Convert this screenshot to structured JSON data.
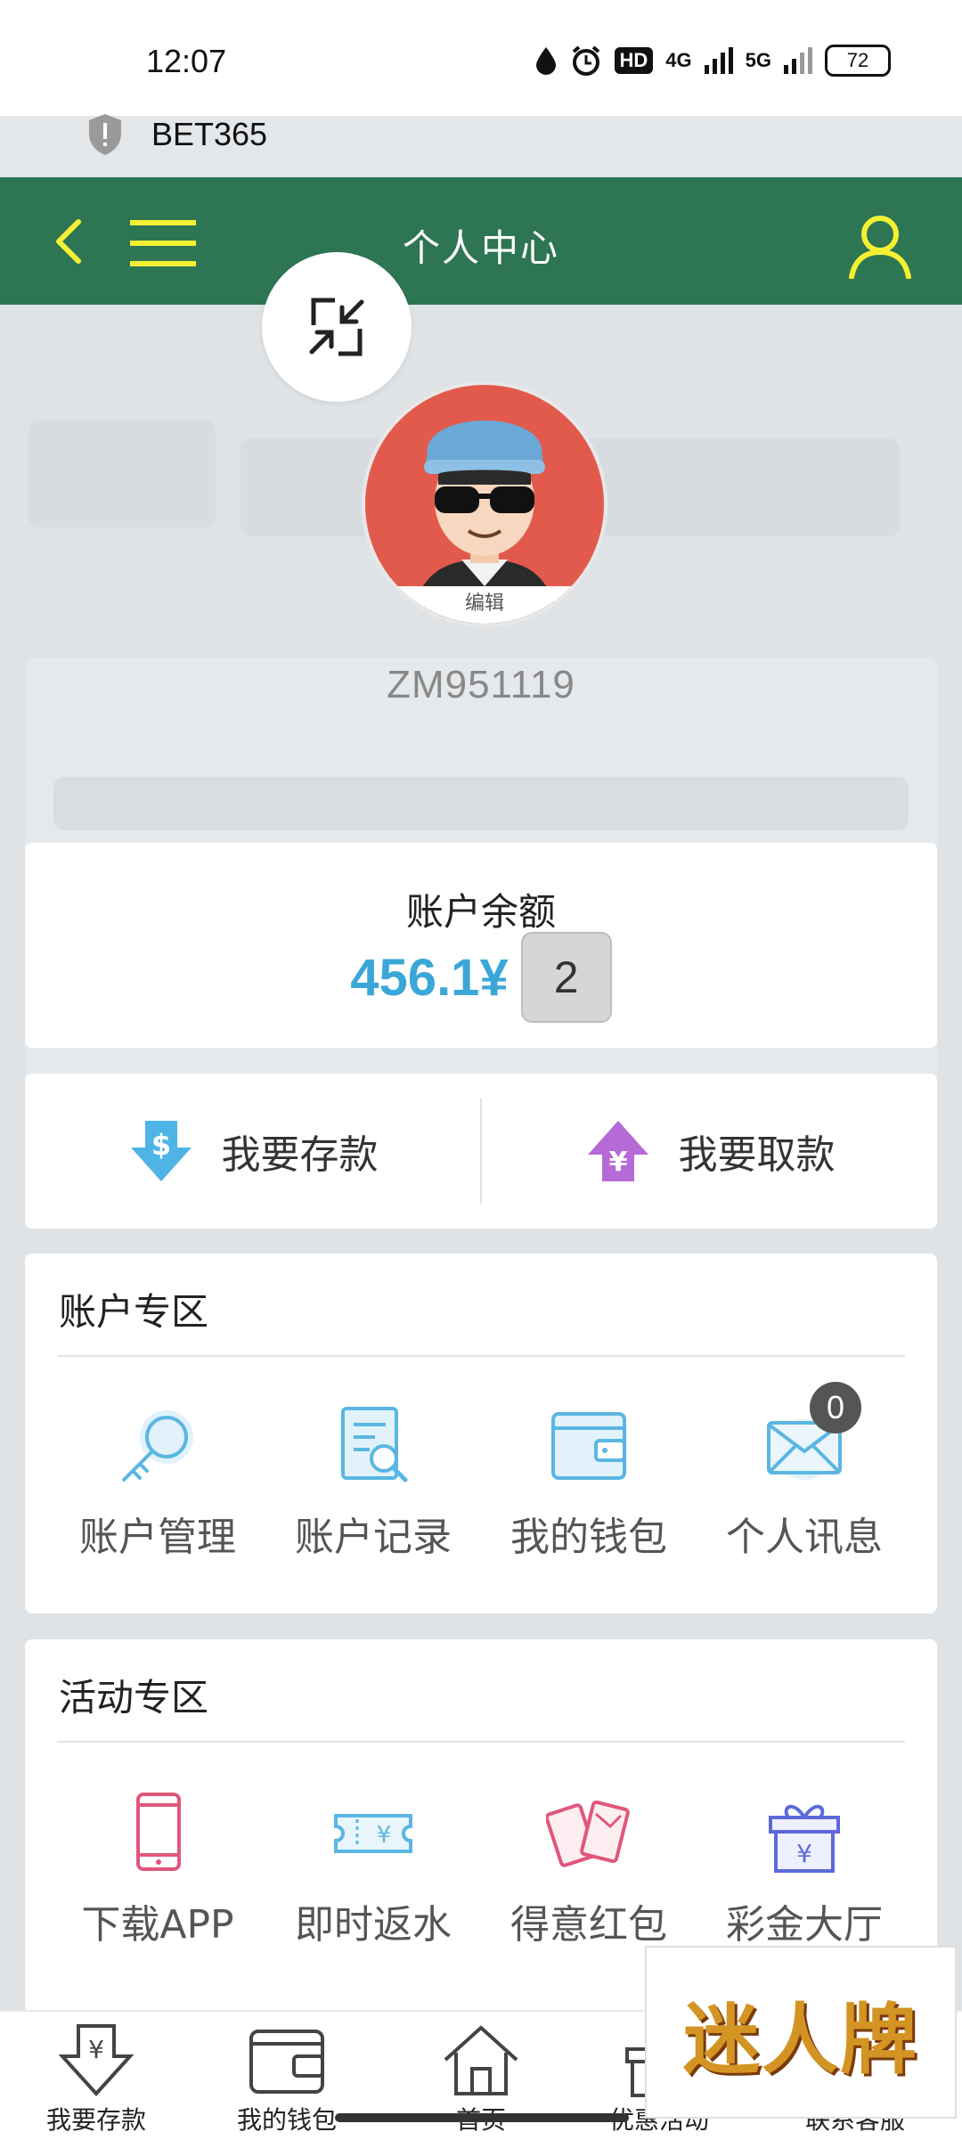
{
  "status_bar": {
    "time": "12:07",
    "battery": "72",
    "network_a": "4G",
    "network_b": "5G",
    "hd_label": "HD"
  },
  "browser": {
    "site_name": "BET365"
  },
  "header": {
    "title": "个人中心"
  },
  "profile": {
    "username": "ZM951119",
    "edit_label": "编辑"
  },
  "balance": {
    "label": "账户余额",
    "value": "456.1¥",
    "badge": "2"
  },
  "actions": {
    "deposit": "我要存款",
    "withdraw": "我要取款"
  },
  "account_section": {
    "title": "账户专区",
    "items": [
      {
        "label": "账户管理",
        "icon": "key-icon"
      },
      {
        "label": "账户记录",
        "icon": "record-search-icon"
      },
      {
        "label": "我的钱包",
        "icon": "wallet-icon"
      },
      {
        "label": "个人讯息",
        "icon": "mail-icon",
        "badge": "0"
      }
    ]
  },
  "activity_section": {
    "title": "活动专区",
    "items": [
      {
        "label": "下载APP",
        "icon": "phone-icon"
      },
      {
        "label": "即时返水",
        "icon": "ticket-icon"
      },
      {
        "label": "得意红包",
        "icon": "red-envelope-icon"
      },
      {
        "label": "彩金大厅",
        "icon": "gift-icon"
      }
    ]
  },
  "bottom_nav": {
    "items": [
      {
        "label": "我要存款",
        "icon": "deposit-icon"
      },
      {
        "label": "我的钱包",
        "icon": "wallet-icon"
      },
      {
        "label": "首页",
        "icon": "home-icon"
      },
      {
        "label": "优惠活动",
        "icon": "gift-icon"
      },
      {
        "label": "联系客服",
        "icon": "service-icon"
      }
    ]
  },
  "ad": {
    "text": "迷人牌"
  },
  "colors": {
    "header": "#2e7553",
    "accent_yellow": "#f4f033",
    "balance_blue": "#3aa7d8"
  }
}
